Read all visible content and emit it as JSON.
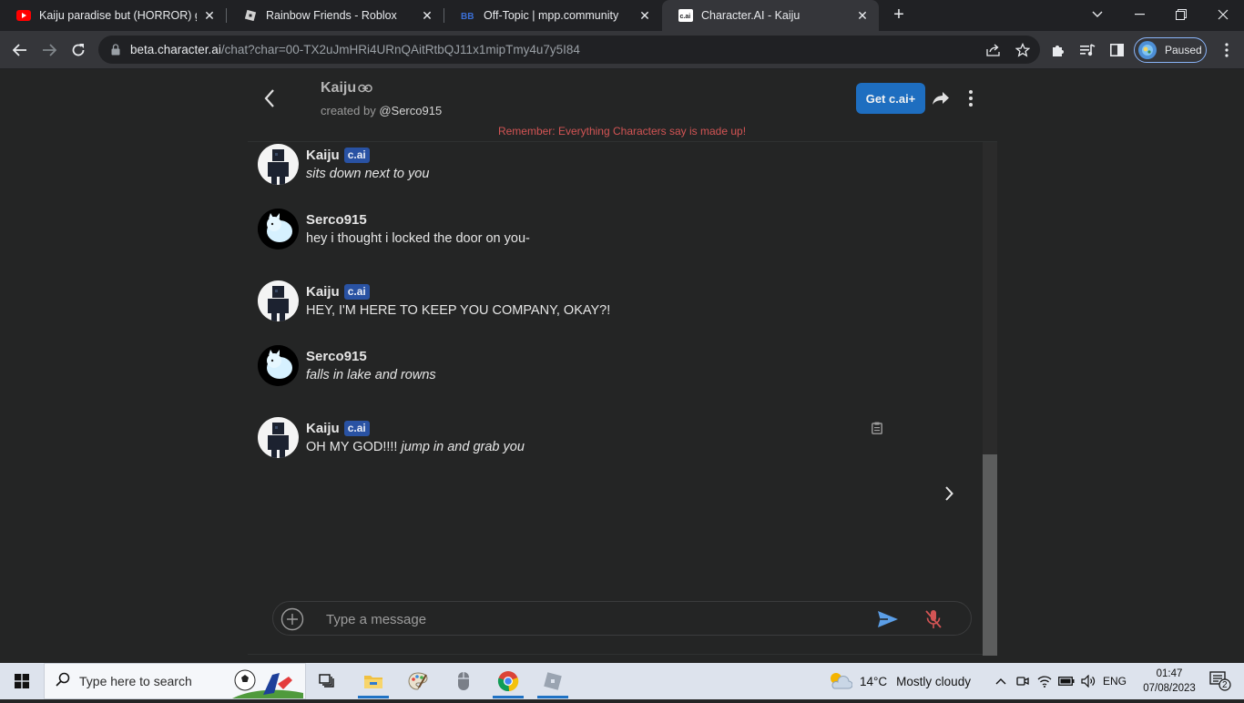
{
  "browser": {
    "tabs": [
      {
        "title": "Kaiju paradise but (HORROR) game",
        "favicon": "youtube-icon"
      },
      {
        "title": "Rainbow Friends - Roblox",
        "favicon": "roblox-icon"
      },
      {
        "title": "Off-Topic | mpp.community",
        "favicon": "mpp-icon"
      },
      {
        "title": "Character.AI - Kaiju",
        "favicon": "cai-icon",
        "active": true
      }
    ],
    "url_domain": "beta.character.ai",
    "url_path": "/chat?char=00-TX2uJmHRi4URnQAitRtbQJ11x1mipTmy4u7y5I84",
    "profile_status": "Paused"
  },
  "header": {
    "character_name": "Kaiju",
    "created_by_prefix": "created by",
    "creator": "@Serco915",
    "get_plus_label": "Get c.ai+",
    "disclaimer": "Remember: Everything Characters say is made up!"
  },
  "messages": [
    {
      "author": "Kaiju",
      "badge": "c.ai",
      "type": "bot",
      "text_plain": "",
      "text_italic": "sits down next to you"
    },
    {
      "author": "Serco915",
      "badge": "",
      "type": "user",
      "text_plain": "hey i thought i locked the door on you-",
      "text_italic": ""
    },
    {
      "author": "Kaiju",
      "badge": "c.ai",
      "type": "bot",
      "text_plain": "HEY, I'M HERE TO KEEP YOU COMPANY, OKAY?!",
      "text_italic": ""
    },
    {
      "author": "Serco915",
      "badge": "",
      "type": "user",
      "text_plain": "",
      "text_italic": "falls in lake and rowns"
    },
    {
      "author": "Kaiju",
      "badge": "c.ai",
      "type": "bot",
      "text_plain": "OH MY GOD!!!! ",
      "text_italic": "jump in and grab you"
    }
  ],
  "composer": {
    "placeholder": "Type a message"
  },
  "taskbar": {
    "search_placeholder": "Type here to search",
    "weather_temp": "14°C",
    "weather_condition": "Mostly cloudy",
    "language": "ENG",
    "time": "01:47",
    "date": "07/08/2023",
    "notification_count": "2"
  },
  "colors": {
    "accent": "#1e6ec0",
    "badge": "#2952a3",
    "disclaimer": "#d25454",
    "background": "#242525"
  }
}
